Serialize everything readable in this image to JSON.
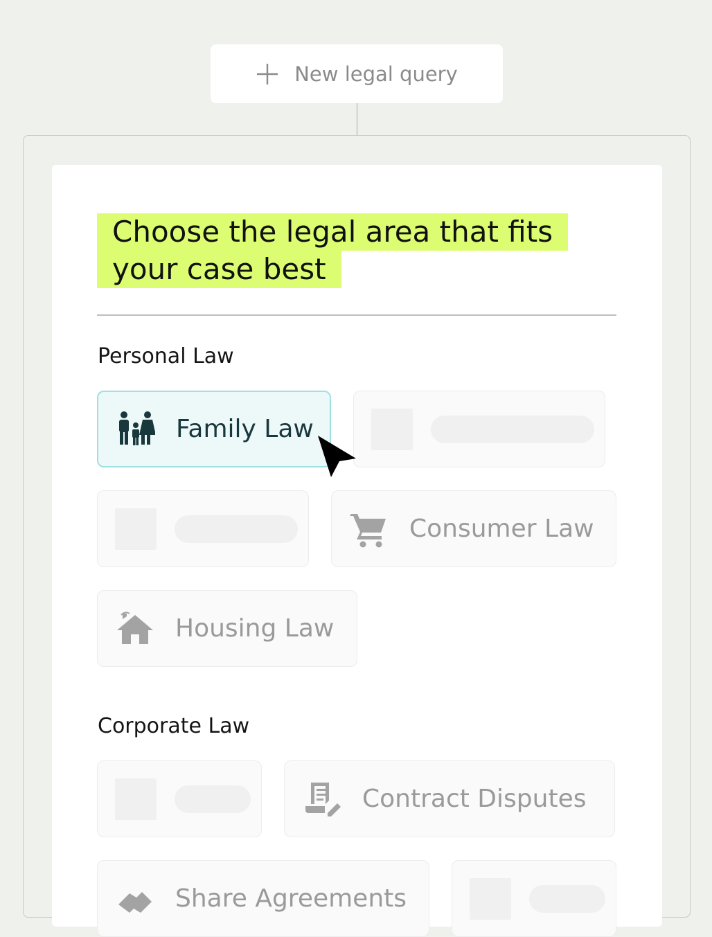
{
  "new_query": {
    "label": "New legal query",
    "icon": "plus-icon"
  },
  "headline": {
    "line1": "Choose the legal area that fits",
    "line2": "your case best",
    "highlight_color": "#dcfd72"
  },
  "sections": {
    "personal": {
      "title": "Personal Law",
      "tiles": {
        "family": {
          "label": "Family Law",
          "icon": "family-icon",
          "selected": true
        },
        "consumer": {
          "label": "Consumer Law",
          "icon": "shopping-cart-icon"
        },
        "housing": {
          "label": "Housing Law",
          "icon": "house-icon"
        }
      }
    },
    "corporate": {
      "title": "Corporate Law",
      "tiles": {
        "contract": {
          "label": "Contract Disputes",
          "icon": "contract-edit-icon"
        },
        "share": {
          "label": "Share Agreements",
          "icon": "handshake-icon"
        }
      }
    }
  },
  "colors": {
    "selected_bg": "#edf8f9",
    "selected_border": "#9fe0e3",
    "selected_text": "#19383d",
    "muted_text": "#9a9a9a",
    "page_bg": "#eff1ec"
  }
}
